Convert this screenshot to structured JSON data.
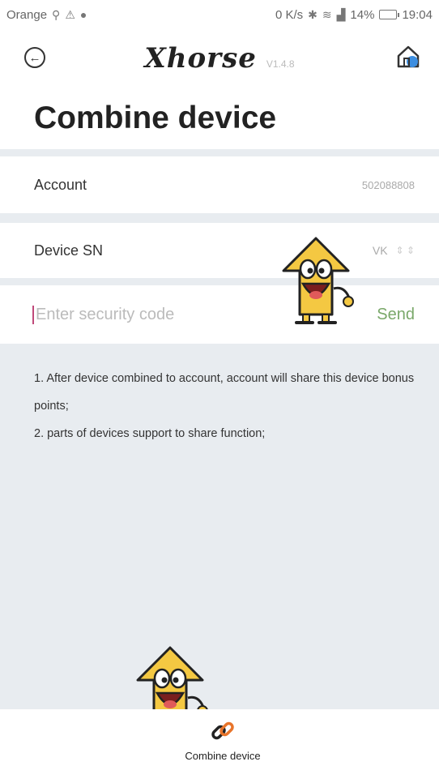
{
  "status_bar": {
    "carrier": "Orange",
    "network_speed": "0 K/s",
    "battery_percent": "14%",
    "time": "19:04"
  },
  "header": {
    "brand": "Xhorse",
    "version": "V1.4.8"
  },
  "page": {
    "title": "Combine device"
  },
  "account_row": {
    "label": "Account",
    "value": "502088808"
  },
  "device_row": {
    "label": "Device SN",
    "value": "VK"
  },
  "security_code": {
    "placeholder": "Enter security code",
    "value": "",
    "send_label": "Send"
  },
  "notes": [
    "1. After device combined to account, account will share this device bonus points;",
    "2. parts of devices support to share function;"
  ],
  "tab_bar": {
    "items": [
      {
        "label": "Combine device",
        "icon": "link-icon"
      }
    ]
  },
  "colors": {
    "send": "#7aa86a",
    "cursor": "#c04a7a",
    "background": "#e8ecf0",
    "link_icon_accent": "#e8742a"
  }
}
